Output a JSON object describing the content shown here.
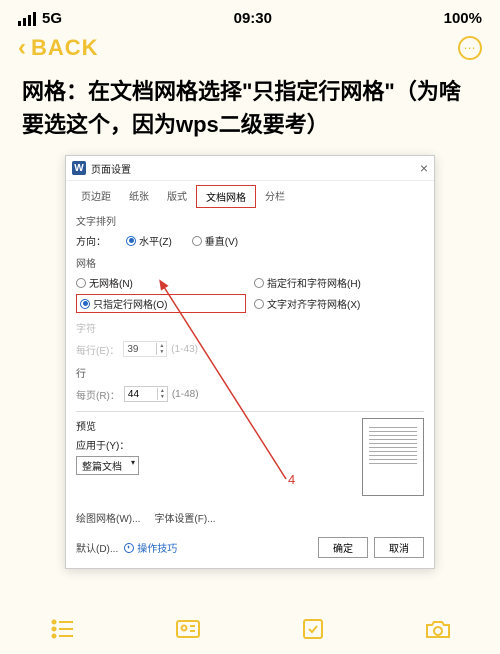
{
  "status": {
    "network": "5G",
    "time": "09:30",
    "battery": "100%"
  },
  "nav": {
    "back": "BACK"
  },
  "title": "网格：在文档网格选择\"只指定行网格\"（为啥要选这个，因为wps二级要考）",
  "dialog": {
    "title": "页面设置",
    "tabs": [
      "页边距",
      "纸张",
      "版式",
      "文档网格",
      "分栏"
    ],
    "text_dir_label": "文字排列",
    "direction_label": "方向：",
    "dir_h": "水平(Z)",
    "dir_v": "垂直(V)",
    "grid_label": "网格",
    "grid_none": "无网格(N)",
    "grid_rowchar": "指定行和字符网格(H)",
    "grid_rowonly": "只指定行网格(O)",
    "grid_align": "文字对齐字符网格(X)",
    "char_label": "字符",
    "per_line": "每行(E)：",
    "per_line_val": "39",
    "per_line_range": "(1-43)",
    "line_label": "行",
    "per_page": "每页(R)：",
    "per_page_val": "44",
    "per_page_range": "(1-48)",
    "preview": "预览",
    "apply": "应用于(Y)：",
    "apply_val": "整篇文档",
    "draw_grid": "绘图网格(W)...",
    "font_set": "字体设置(F)...",
    "default": "默认(D)...",
    "tips": "操作技巧",
    "ok": "确定",
    "cancel": "取消",
    "anno": "4"
  }
}
